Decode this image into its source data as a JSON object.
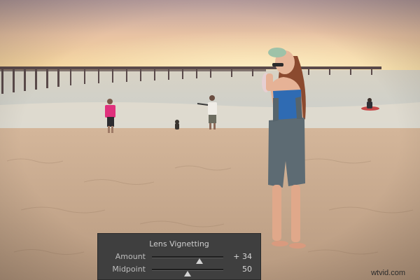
{
  "vignetting_panel": {
    "title": "Lens Vignetting",
    "sliders": [
      {
        "label": "Amount",
        "value_text": "+ 34",
        "value": 34,
        "min": -100,
        "max": 100
      },
      {
        "label": "Midpoint",
        "value_text": "50",
        "value": 50,
        "min": 0,
        "max": 100
      }
    ]
  },
  "watermark": "wtvid.com",
  "colors": {
    "panel_bg": "#3f3f3f",
    "sky_top": "#cfa8a0",
    "sunset_glow": "#f7d48f",
    "sea": "#c8d2d0",
    "sand": "#c9a98a"
  }
}
